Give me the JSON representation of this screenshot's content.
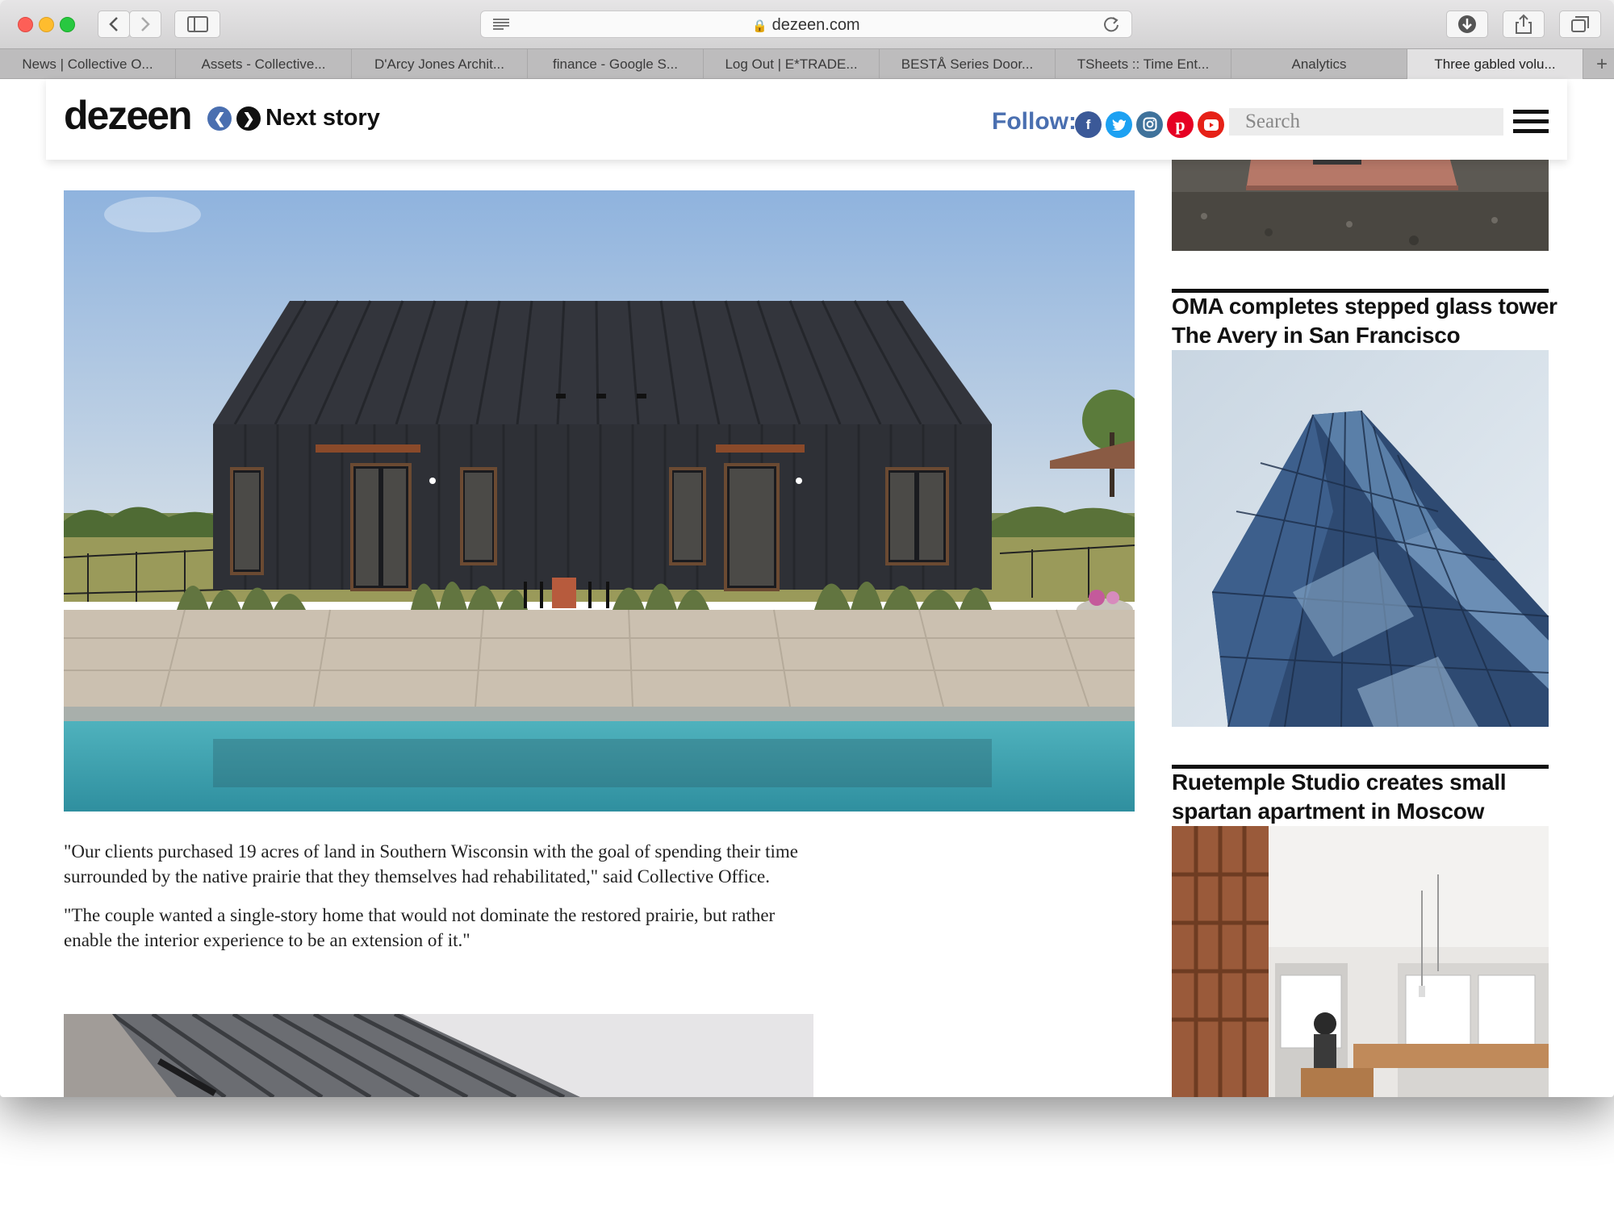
{
  "browser": {
    "url": "dezeen.com",
    "tabs": [
      {
        "label": "News | Collective O..."
      },
      {
        "label": "Assets - Collective..."
      },
      {
        "label": "D'Arcy Jones Archit..."
      },
      {
        "label": "finance - Google S..."
      },
      {
        "label": "Log Out | E*TRADE..."
      },
      {
        "label": "BESTÅ Series Door..."
      },
      {
        "label": "TSheets :: Time Ent..."
      },
      {
        "label": "Analytics"
      },
      {
        "label": "Three gabled volu..."
      }
    ],
    "new_tab": "+"
  },
  "site": {
    "logo": "dezeen",
    "next_story": "Next story",
    "follow": "Follow:",
    "social_icons": [
      "facebook-icon",
      "twitter-icon",
      "instagram-icon",
      "pinterest-icon",
      "youtube-icon"
    ],
    "social_colors": [
      "#3b5998",
      "#1da1f2",
      "#3f729b",
      "#e60023",
      "#e62117"
    ],
    "search_placeholder": "Search"
  },
  "article": {
    "paragraphs": [
      "\"Our clients purchased 19 acres of land in Southern Wisconsin with the goal of spending their time surrounded by the native prairie that they themselves had rehabilitated,\" said Collective Office.",
      "\"The couple wanted a single-story home that would not dominate the restored prairie, but rather enable the interior experience to be an extension of it.\""
    ]
  },
  "sidebar": {
    "stories": [
      {
        "title": "OMA completes stepped glass tower The Avery in San Francisco"
      },
      {
        "title": "Ruetemple Studio creates small spartan apartment in Moscow"
      }
    ]
  }
}
